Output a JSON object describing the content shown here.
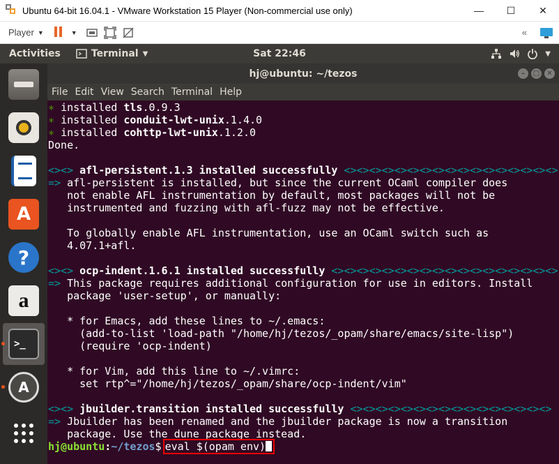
{
  "vmware": {
    "title": "Ubuntu 64-bit 16.04.1 - VMware Workstation 15 Player (Non-commercial use only)",
    "minimize": "—",
    "maximize": "☐",
    "close": "✕",
    "player_menu": "Player",
    "send_ctrl_alt_del": "ctrl-alt-del-icon",
    "accent_color": "#e8662a"
  },
  "topbar": {
    "activities": "Activities",
    "app_menu": "Terminal",
    "clock": "Sat 22:46"
  },
  "dock": {
    "items": [
      {
        "name": "files",
        "icon": "file-cabinet-icon"
      },
      {
        "name": "rhythmbox",
        "icon": "speaker-icon"
      },
      {
        "name": "writer",
        "icon": "document-icon"
      },
      {
        "name": "software",
        "icon": "shopping-bag-icon"
      },
      {
        "name": "help",
        "icon": "help-icon"
      },
      {
        "name": "amazon",
        "icon": "amazon-icon"
      },
      {
        "name": "terminal",
        "icon": "terminal-icon"
      },
      {
        "name": "updater",
        "icon": "software-update-icon"
      },
      {
        "name": "apps",
        "icon": "app-grid-icon"
      }
    ]
  },
  "terminal": {
    "title": "hj@ubuntu: ~/tezos",
    "menu": [
      "File",
      "Edit",
      "View",
      "Search",
      "Terminal",
      "Help"
    ],
    "lines": {
      "l1_pkg": "tls",
      "l1_ver": ".0.9.3",
      "l2_pkg": "conduit-lwt-unix",
      "l2_ver": ".1.4.0",
      "l3_pkg": "cohttp-lwt-unix",
      "l3_ver": ".1.2.0",
      "installed": "installed",
      "done": "Done.",
      "afl_header": "afl-persistent.1.3 installed successfully",
      "afl_1": "afl-persistent is installed, but since the current OCaml compiler does",
      "afl_2": "not enable AFL instrumentation by default, most packages will not be",
      "afl_3": "instrumented and fuzzing with afl-fuzz may not be effective.",
      "afl_4": "To globally enable AFL instrumentation, use an OCaml switch such as",
      "afl_5": "4.07.1+afl.",
      "ocp_header": "ocp-indent.1.6.1 installed successfully",
      "ocp_1": "This package requires additional configuration for use in editors. Install",
      "ocp_2": "package 'user-setup', or manually:",
      "ocp_3": "* for Emacs, add these lines to ~/.emacs:",
      "ocp_4": "(add-to-list 'load-path \"/home/hj/tezos/_opam/share/emacs/site-lisp\")",
      "ocp_5": "(require 'ocp-indent)",
      "ocp_6": "* for Vim, add this line to ~/.vimrc:",
      "ocp_7": "set rtp^=\"/home/hj/tezos/_opam/share/ocp-indent/vim\"",
      "jb_header": "jbuilder.transition installed successfully",
      "jb_1": "Jbuilder has been renamed and the jbuilder package is now a transition",
      "jb_2": "package. Use the dune package instead.",
      "prompt_user": "hj@ubuntu",
      "prompt_path": "~/tezos",
      "command": "eval $(opam env)"
    }
  }
}
